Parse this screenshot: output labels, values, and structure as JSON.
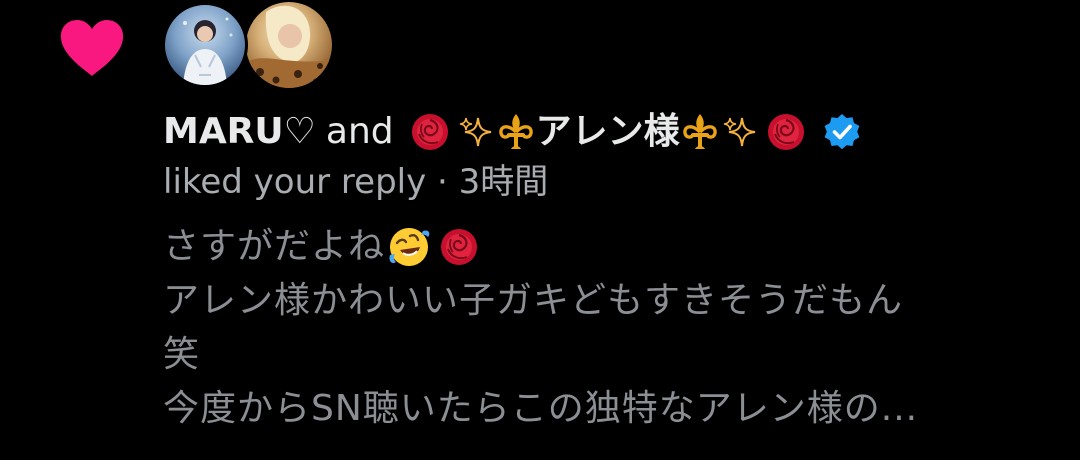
{
  "notification": {
    "type_icon": "heart-icon",
    "avatars": [
      {
        "icon": "avatar-performer-photo"
      },
      {
        "icon": "avatar-leopard-photo"
      }
    ],
    "user1_name": "MARU♡",
    "joiner": "and",
    "user2_name_text": "アレン様",
    "user2_name_emoji": [
      "rose",
      "sparkles",
      "fleur-de-lis",
      "fleur-de-lis",
      "sparkles",
      "rose"
    ],
    "user2_verified": "verified-badge-icon",
    "action_text": "liked your reply · 3時間",
    "reply_lines": [
      "さすがだよね",
      "アレン様かわいい子ガキどもすきそうだもん",
      "笑",
      "今度からSN聴いたらこの独特なアレン様の..."
    ],
    "reply_line1_emoji": [
      "rolling-on-floor-laughing",
      "rose"
    ]
  },
  "colors": {
    "background": "#000000",
    "heart": "#f91880",
    "primary_text": "#e7e9ea",
    "secondary_text": "#a9adb1",
    "reply_text": "#8b8f94",
    "verified": "#1d9bf0"
  }
}
